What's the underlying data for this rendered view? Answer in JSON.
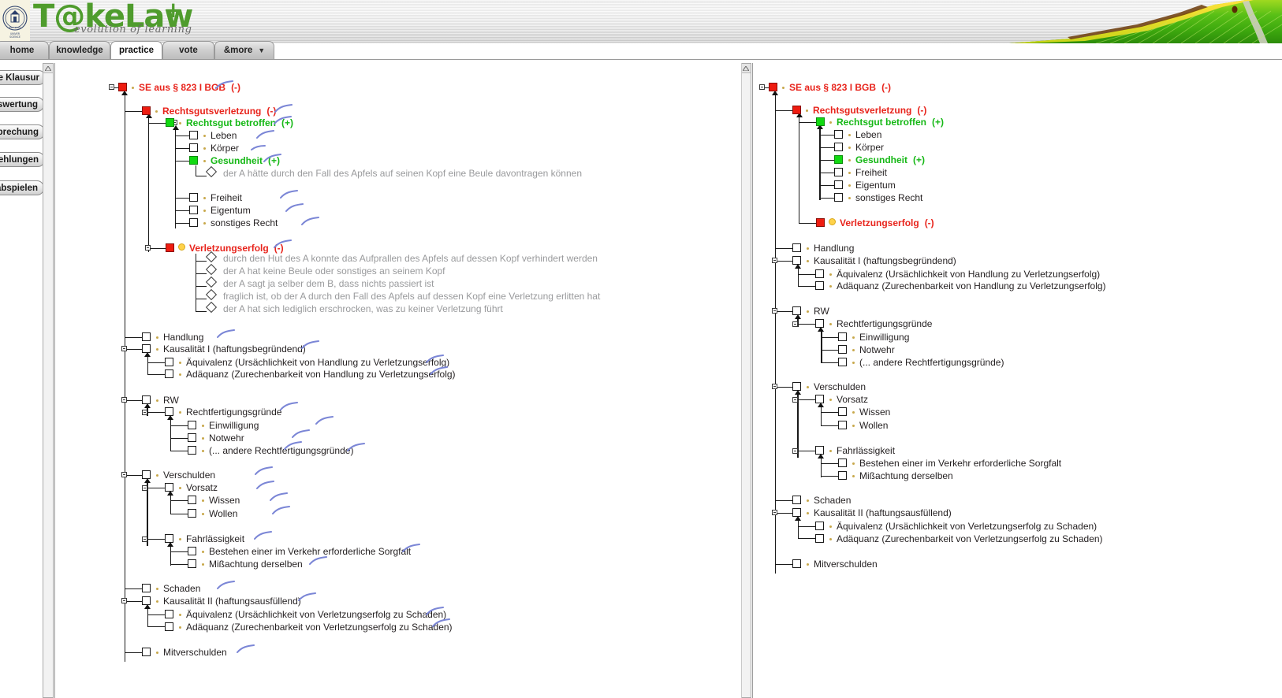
{
  "app": {
    "logo_text": "T@keLaw",
    "logo_plus": "+",
    "tagline": "evolution of learning",
    "crest_icon": "university-crest-icon",
    "leaf_icon": "banana-leaf-banner-image"
  },
  "tabs": [
    {
      "label": "home",
      "active": false
    },
    {
      "label": "knowledge",
      "active": false
    },
    {
      "label": "practice",
      "active": true
    },
    {
      "label": "vote",
      "active": false
    },
    {
      "label": "&more",
      "active": false,
      "caret": "▼"
    }
  ],
  "sidebar": {
    "items": [
      {
        "label": "neue Klausur"
      },
      {
        "label": "Auswertung"
      },
      {
        "label": "Besprechung"
      },
      {
        "label": "Empfehlungen"
      },
      {
        "label": "Lösung abspielen"
      }
    ]
  },
  "colors": {
    "brand_green": "#4f9c2d",
    "node_red": "#e8241c",
    "node_green": "#16b816",
    "note_gray": "#999a9c",
    "bullet_gold": "#c8a84b",
    "marker_orange": "#ffd24a"
  },
  "panels": {
    "left": {
      "name": "expanded-tree-panel",
      "tree": [
        {
          "id": "l1",
          "text": "SE aus § 823 I BGB",
          "sign": "(-)",
          "style": "red",
          "box": "red",
          "depth": 0
        },
        {
          "id": "l2",
          "text": "Rechtsgutsverletzung",
          "sign": "(-)",
          "style": "red",
          "box": "red",
          "depth": 1
        },
        {
          "id": "l3",
          "text": "Rechtsgut betroffen",
          "sign": "(+)",
          "style": "green",
          "box": "green",
          "depth": 2
        },
        {
          "id": "l4",
          "text": "Leben",
          "sign": "",
          "style": "dark",
          "box": "empty",
          "depth": 3
        },
        {
          "id": "l5",
          "text": "Körper",
          "sign": "",
          "style": "dark",
          "box": "empty",
          "depth": 3
        },
        {
          "id": "l6",
          "text": "Gesundheit",
          "sign": "(+)",
          "style": "green",
          "box": "green",
          "depth": 3
        },
        {
          "id": "l7",
          "text": "der A hätte durch den Fall des Apfels auf seinen Kopf eine Beule davontragen können",
          "style": "note",
          "box": "diamond",
          "depth": 4
        },
        {
          "id": "l8",
          "text": "Freiheit",
          "sign": "",
          "style": "dark",
          "box": "empty",
          "depth": 3
        },
        {
          "id": "l9",
          "text": "Eigentum",
          "sign": "",
          "style": "dark",
          "box": "empty",
          "depth": 3
        },
        {
          "id": "l10",
          "text": "sonstiges Recht",
          "sign": "",
          "style": "dark",
          "box": "empty",
          "depth": 3
        },
        {
          "id": "l11",
          "text": "Verletzungserfolg",
          "sign": "(-)",
          "style": "red",
          "box": "red-dot",
          "depth": 2
        },
        {
          "id": "l12",
          "text": "durch den Hut des A konnte das Aufprallen des Apfels auf dessen Kopf verhindert werden",
          "style": "note",
          "box": "diamond",
          "depth": 3
        },
        {
          "id": "l13",
          "text": "der A hat keine Beule oder sonstiges an seinem Kopf",
          "style": "note",
          "box": "diamond",
          "depth": 3
        },
        {
          "id": "l14",
          "text": "der A sagt ja selber dem B, dass nichts passiert ist",
          "style": "note",
          "box": "diamond",
          "depth": 3
        },
        {
          "id": "l15",
          "text": "fraglich ist, ob der A durch den Fall des Apfels auf dessen Kopf eine Verletzung erlitten hat",
          "style": "note",
          "box": "diamond",
          "depth": 3
        },
        {
          "id": "l16",
          "text": "der A hat sich lediglich erschrocken, was zu keiner Verletzung führt",
          "style": "note",
          "box": "diamond",
          "depth": 3
        },
        {
          "id": "l17",
          "text": "Handlung",
          "sign": "",
          "style": "dark",
          "box": "empty",
          "depth": 1
        },
        {
          "id": "l18",
          "text": "Kausalität I (haftungsbegründend)",
          "sign": "",
          "style": "dark",
          "box": "empty",
          "depth": 1
        },
        {
          "id": "l19",
          "text": "Äquivalenz (Ursächlichkeit von Handlung zu Verletzungserfolg)",
          "sign": "",
          "style": "dark",
          "box": "empty",
          "depth": 2
        },
        {
          "id": "l20",
          "text": "Adäquanz (Zurechenbarkeit von Handlung zu Verletzungserfolg)",
          "sign": "",
          "style": "dark",
          "box": "empty",
          "depth": 2
        },
        {
          "id": "l21",
          "text": "RW",
          "sign": "",
          "style": "dark",
          "box": "empty",
          "depth": 1
        },
        {
          "id": "l22",
          "text": "Rechtfertigungsgründe",
          "sign": "",
          "style": "dark",
          "box": "empty",
          "depth": 2
        },
        {
          "id": "l23",
          "text": "Einwilligung",
          "sign": "",
          "style": "dark",
          "box": "empty",
          "depth": 3
        },
        {
          "id": "l24",
          "text": "Notwehr",
          "sign": "",
          "style": "dark",
          "box": "empty",
          "depth": 3
        },
        {
          "id": "l25",
          "text": "(... andere Rechtfertigungsgründe)",
          "sign": "",
          "style": "dark",
          "box": "empty",
          "depth": 3
        },
        {
          "id": "l26",
          "text": "Verschulden",
          "sign": "",
          "style": "dark",
          "box": "empty",
          "depth": 1
        },
        {
          "id": "l27",
          "text": "Vorsatz",
          "sign": "",
          "style": "dark",
          "box": "empty",
          "depth": 2
        },
        {
          "id": "l28",
          "text": "Wissen",
          "sign": "",
          "style": "dark",
          "box": "empty",
          "depth": 3
        },
        {
          "id": "l29",
          "text": "Wollen",
          "sign": "",
          "style": "dark",
          "box": "empty",
          "depth": 3
        },
        {
          "id": "l30",
          "text": "Fahrlässigkeit",
          "sign": "",
          "style": "dark",
          "box": "empty",
          "depth": 2
        },
        {
          "id": "l31",
          "text": "Bestehen einer im Verkehr erforderliche Sorgfalt",
          "sign": "",
          "style": "dark",
          "box": "empty",
          "depth": 3
        },
        {
          "id": "l32",
          "text": "Mißachtung derselben",
          "sign": "",
          "style": "dark",
          "box": "empty",
          "depth": 3
        },
        {
          "id": "l33",
          "text": "Schaden",
          "sign": "",
          "style": "dark",
          "box": "empty",
          "depth": 1
        },
        {
          "id": "l34",
          "text": "Kausalität II (haftungsausfüllend)",
          "sign": "",
          "style": "dark",
          "box": "empty",
          "depth": 1
        },
        {
          "id": "l35",
          "text": "Äquivalenz (Ursächlichkeit von Verletzungserfolg zu Schaden)",
          "sign": "",
          "style": "dark",
          "box": "empty",
          "depth": 2
        },
        {
          "id": "l36",
          "text": "Adäquanz (Zurechenbarkeit von Verletzungserfolg zu Schaden)",
          "sign": "",
          "style": "dark",
          "box": "empty",
          "depth": 2
        },
        {
          "id": "l37",
          "text": "Mitverschulden",
          "sign": "",
          "style": "dark",
          "box": "empty",
          "depth": 1
        }
      ]
    },
    "right": {
      "name": "reference-tree-panel",
      "tree": [
        {
          "id": "r1",
          "text": "SE aus § 823 I BGB",
          "sign": "(-)",
          "style": "red",
          "box": "red",
          "depth": 0
        },
        {
          "id": "r2",
          "text": "Rechtsgutsverletzung",
          "sign": "(-)",
          "style": "red",
          "box": "red",
          "depth": 1
        },
        {
          "id": "r3",
          "text": "Rechtsgut betroffen",
          "sign": "(+)",
          "style": "green",
          "box": "green",
          "depth": 2
        },
        {
          "id": "r4",
          "text": "Leben",
          "sign": "",
          "style": "dark",
          "box": "empty",
          "depth": 3
        },
        {
          "id": "r5",
          "text": "Körper",
          "sign": "",
          "style": "dark",
          "box": "empty",
          "depth": 3
        },
        {
          "id": "r6",
          "text": "Gesundheit",
          "sign": "(+)",
          "style": "green",
          "box": "green",
          "depth": 3
        },
        {
          "id": "r7",
          "text": "Freiheit",
          "sign": "",
          "style": "dark",
          "box": "empty",
          "depth": 3
        },
        {
          "id": "r8",
          "text": "Eigentum",
          "sign": "",
          "style": "dark",
          "box": "empty",
          "depth": 3
        },
        {
          "id": "r9",
          "text": "sonstiges Recht",
          "sign": "",
          "style": "dark",
          "box": "empty",
          "depth": 3
        },
        {
          "id": "r10",
          "text": "Verletzungserfolg",
          "sign": "(-)",
          "style": "red",
          "box": "red-dot",
          "depth": 2
        },
        {
          "id": "r11",
          "text": "Handlung",
          "sign": "",
          "style": "dark",
          "box": "empty",
          "depth": 1
        },
        {
          "id": "r12",
          "text": "Kausalität I (haftungsbegründend)",
          "sign": "",
          "style": "dark",
          "box": "empty",
          "depth": 1
        },
        {
          "id": "r13",
          "text": "Äquivalenz (Ursächlichkeit von Handlung zu Verletzungserfolg)",
          "sign": "",
          "style": "dark",
          "box": "empty",
          "depth": 2
        },
        {
          "id": "r14",
          "text": "Adäquanz (Zurechenbarkeit von Handlung zu Verletzungserfolg)",
          "sign": "",
          "style": "dark",
          "box": "empty",
          "depth": 2
        },
        {
          "id": "r15",
          "text": "RW",
          "sign": "",
          "style": "dark",
          "box": "empty",
          "depth": 1
        },
        {
          "id": "r16",
          "text": "Rechtfertigungsgründe",
          "sign": "",
          "style": "dark",
          "box": "empty",
          "depth": 2
        },
        {
          "id": "r17",
          "text": "Einwilligung",
          "sign": "",
          "style": "dark",
          "box": "empty",
          "depth": 3
        },
        {
          "id": "r18",
          "text": "Notwehr",
          "sign": "",
          "style": "dark",
          "box": "empty",
          "depth": 3
        },
        {
          "id": "r19",
          "text": "(... andere Rechtfertigungsgründe)",
          "sign": "",
          "style": "dark",
          "box": "empty",
          "depth": 3
        },
        {
          "id": "r20",
          "text": "Verschulden",
          "sign": "",
          "style": "dark",
          "box": "empty",
          "depth": 1
        },
        {
          "id": "r21",
          "text": "Vorsatz",
          "sign": "",
          "style": "dark",
          "box": "empty",
          "depth": 2
        },
        {
          "id": "r22",
          "text": "Wissen",
          "sign": "",
          "style": "dark",
          "box": "empty",
          "depth": 3
        },
        {
          "id": "r23",
          "text": "Wollen",
          "sign": "",
          "style": "dark",
          "box": "empty",
          "depth": 3
        },
        {
          "id": "r24",
          "text": "Fahrlässigkeit",
          "sign": "",
          "style": "dark",
          "box": "empty",
          "depth": 2
        },
        {
          "id": "r25",
          "text": "Bestehen einer im Verkehr erforderliche Sorgfalt",
          "sign": "",
          "style": "dark",
          "box": "empty",
          "depth": 3
        },
        {
          "id": "r26",
          "text": "Mißachtung derselben",
          "sign": "",
          "style": "dark",
          "box": "empty",
          "depth": 3
        },
        {
          "id": "r27",
          "text": "Schaden",
          "sign": "",
          "style": "dark",
          "box": "empty",
          "depth": 1
        },
        {
          "id": "r28",
          "text": "Kausalität II (haftungsausfüllend)",
          "sign": "",
          "style": "dark",
          "box": "empty",
          "depth": 1
        },
        {
          "id": "r29",
          "text": "Äquivalenz (Ursächlichkeit von Verletzungserfolg zu Schaden)",
          "sign": "",
          "style": "dark",
          "box": "empty",
          "depth": 2
        },
        {
          "id": "r30",
          "text": "Adäquanz (Zurechenbarkeit von Verletzungserfolg zu Schaden)",
          "sign": "",
          "style": "dark",
          "box": "empty",
          "depth": 2
        },
        {
          "id": "r31",
          "text": "Mitverschulden",
          "sign": "",
          "style": "dark",
          "box": "empty",
          "depth": 1
        }
      ]
    }
  }
}
